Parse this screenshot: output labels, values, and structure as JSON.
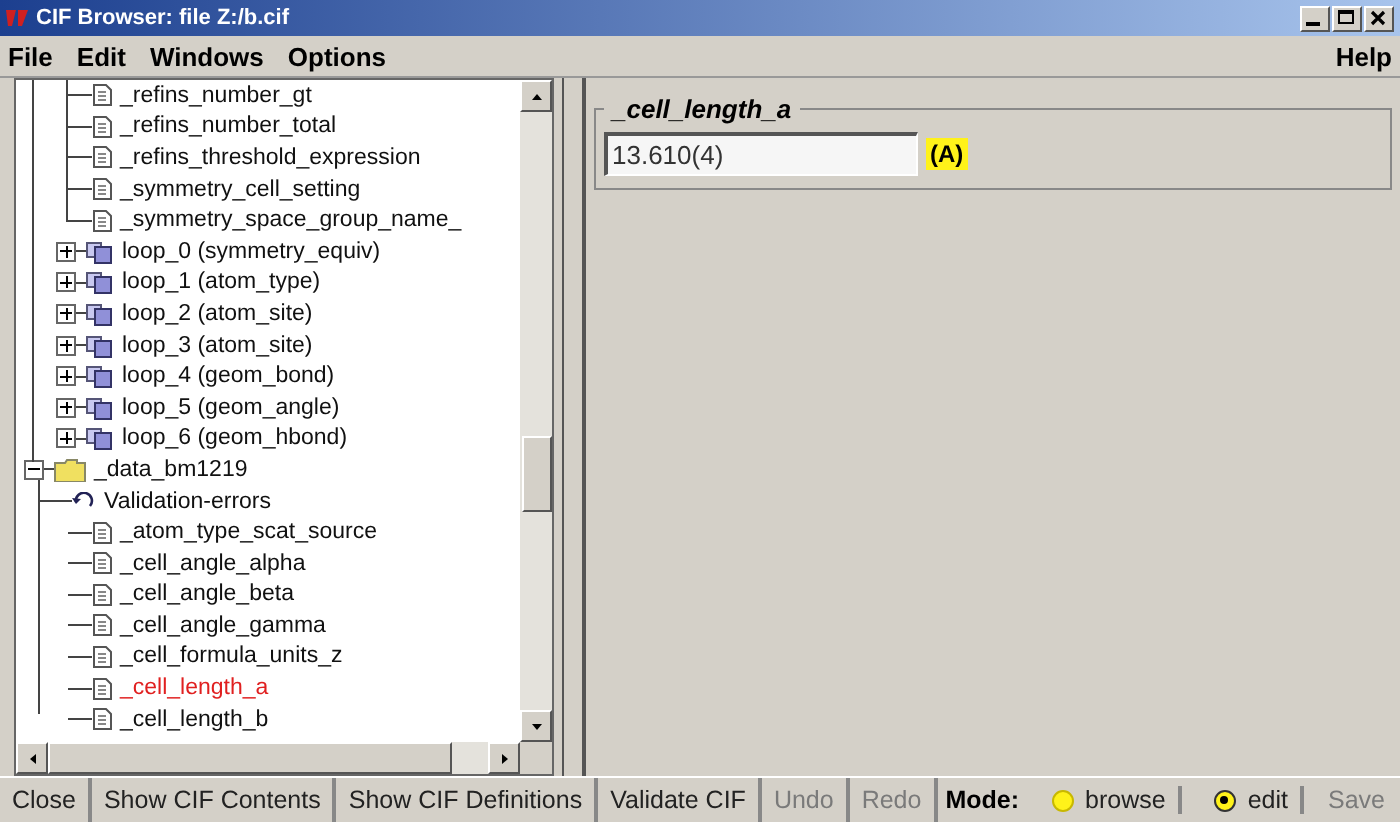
{
  "window": {
    "title": "CIF Browser: file Z:/b.cif"
  },
  "menu": [
    "File",
    "Edit",
    "Windows",
    "Options"
  ],
  "help_menu": "Help",
  "tree": [
    {
      "children": [
        {
          "kind": "item",
          "label": "_refins_number_gt",
          "selected": false
        },
        {
          "kind": "item",
          "label": "_refins_number_total",
          "selected": false
        },
        {
          "kind": "item",
          "label": "_refins_threshold_expression",
          "selected": false
        },
        {
          "kind": "item",
          "label": "_symmetry_cell_setting",
          "selected": false
        },
        {
          "kind": "item",
          "label": "_symmetry_space_group_name_",
          "selected": false
        },
        {
          "kind": "loop",
          "label": "loop_0 (symmetry_equiv)",
          "expanded": false,
          "selected": false
        },
        {
          "kind": "loop",
          "label": "loop_1 (atom_type)",
          "expanded": false,
          "selected": false
        },
        {
          "kind": "loop",
          "label": "loop_2 (atom_site)",
          "expanded": false,
          "selected": false
        },
        {
          "kind": "loop",
          "label": "loop_3 (atom_site)",
          "expanded": false,
          "selected": false
        },
        {
          "kind": "loop",
          "label": "loop_4 (geom_bond)",
          "expanded": false,
          "selected": false
        },
        {
          "kind": "loop",
          "label": "loop_5 (geom_angle)",
          "expanded": false,
          "selected": false
        },
        {
          "kind": "loop",
          "label": "loop_6 (geom_hbond)",
          "expanded": false,
          "selected": false
        }
      ]
    },
    {
      "kind": "folder",
      "label": "_data_bm1219",
      "expanded": true,
      "selected": false,
      "children": [
        {
          "kind": "validation",
          "label": "Validation-errors",
          "selected": false
        },
        {
          "kind": "item",
          "label": "_atom_type_scat_source",
          "selected": false
        },
        {
          "kind": "item",
          "label": "_cell_angle_alpha",
          "selected": false
        },
        {
          "kind": "item",
          "label": "_cell_angle_beta",
          "selected": false
        },
        {
          "kind": "item",
          "label": "_cell_angle_gamma",
          "selected": false
        },
        {
          "kind": "item",
          "label": "_cell_formula_units_z",
          "selected": false
        },
        {
          "kind": "item",
          "label": "_cell_length_a",
          "selected": true
        },
        {
          "kind": "item",
          "label": "_cell_length_b",
          "selected": false
        }
      ]
    }
  ],
  "editor": {
    "title": "_cell_length_a",
    "value": "13.610(4)",
    "unit": "(A)"
  },
  "buttons": [
    {
      "label": "Close",
      "disabled": false
    },
    {
      "label": "Show CIF Contents",
      "disabled": false
    },
    {
      "label": "Show CIF Definitions",
      "disabled": false
    },
    {
      "label": "Validate CIF",
      "disabled": false
    },
    {
      "label": "Undo",
      "disabled": true
    },
    {
      "label": "Redo",
      "disabled": true
    }
  ],
  "mode": {
    "label": "Mode:",
    "options": [
      {
        "label": "browse",
        "selected": false
      },
      {
        "label": "edit",
        "selected": true
      }
    ]
  },
  "save": {
    "label": "Save",
    "disabled": true
  }
}
